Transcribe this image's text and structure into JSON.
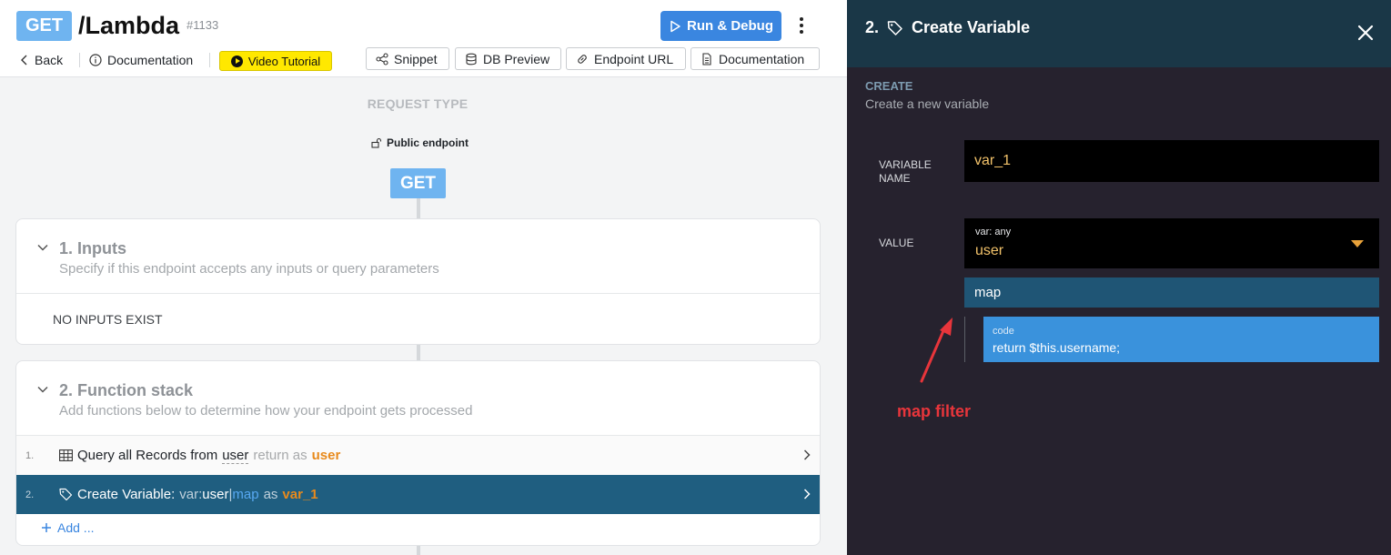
{
  "header": {
    "method": "GET",
    "path": "/Lambda",
    "endpoint_id": "#1133",
    "run_debug_label": "Run & Debug",
    "back_label": "Back",
    "documentation_label": "Documentation",
    "video_tutorial_label": "Video Tutorial",
    "toolbar": {
      "snippet": "Snippet",
      "db_preview": "DB Preview",
      "endpoint_url": "Endpoint URL",
      "documentation": "Documentation"
    }
  },
  "request": {
    "type_label": "REQUEST TYPE",
    "access_label": "Public endpoint",
    "method": "GET"
  },
  "inputs_card": {
    "title": "1. Inputs",
    "description": "Specify if this endpoint accepts any inputs or query parameters",
    "empty_label": "NO INPUTS EXIST"
  },
  "function_stack": {
    "title": "2. Function stack",
    "description": "Add functions below to determine how your endpoint gets processed",
    "rows": [
      {
        "num": "1.",
        "label": "Query all Records from",
        "table": "user",
        "return_label": "return as",
        "var": "user"
      },
      {
        "num": "2.",
        "label": "Create Variable:",
        "var_prefix": "var:",
        "var_name": "user",
        "pipe": "|",
        "filter": "map",
        "as_label": "as",
        "result": "var_1"
      }
    ],
    "add_label": "Add ..."
  },
  "panel": {
    "step": "2.",
    "title": "Create Variable",
    "section_title": "CREATE",
    "section_desc": "Create a new variable",
    "variable_name_label_1": "VARIABLE",
    "variable_name_label_2": "NAME",
    "variable_name_value": "var_1",
    "value_label": "VALUE",
    "value_type": "var: any",
    "value": "user",
    "filter": "map",
    "code_label": "code",
    "code": "return $this.username;",
    "annotation": "map filter"
  },
  "colors": {
    "get_badge": "#6fb4f0",
    "primary": "#3a86e0",
    "selected_row": "#1f5e80",
    "panel_bg": "#26222e",
    "panel_header": "#1a3747",
    "accent_orange": "#e88a1c",
    "annotation_red": "#e8353b"
  }
}
